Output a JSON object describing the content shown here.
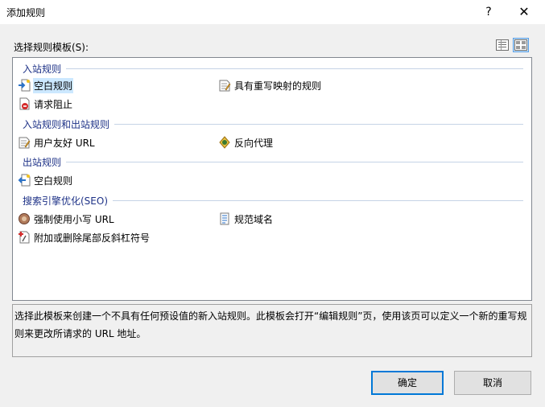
{
  "window": {
    "title": "添加规则",
    "help_glyph": "?",
    "close_glyph": "✕"
  },
  "select_label": "选择规则模板(S):",
  "view_buttons": [
    "list-view-icon",
    "tile-view-icon"
  ],
  "groups": [
    {
      "header": "入站规则",
      "items": [
        {
          "label": "空白规则",
          "icon": "inbound-blank-rule-icon",
          "selected": true
        },
        {
          "label": "具有重写映射的规则",
          "icon": "rewrite-map-rule-icon"
        },
        {
          "label": "请求阻止",
          "icon": "request-blocking-icon"
        }
      ]
    },
    {
      "header": "入站规则和出站规则",
      "items": [
        {
          "label": "用户友好 URL",
          "icon": "user-friendly-url-icon"
        },
        {
          "label": "反向代理",
          "icon": "reverse-proxy-icon"
        }
      ]
    },
    {
      "header": "出站规则",
      "items": [
        {
          "label": "空白规则",
          "icon": "outbound-blank-rule-icon"
        }
      ]
    },
    {
      "header": "搜索引擎优化(SEO)",
      "items": [
        {
          "label": "强制使用小写 URL",
          "icon": "enforce-lowercase-url-icon"
        },
        {
          "label": "规范域名",
          "icon": "canonical-domain-icon"
        },
        {
          "label": "附加或删除尾部反斜杠符号",
          "icon": "trailing-slash-icon"
        }
      ]
    }
  ],
  "description": "选择此模板来创建一个不具有任何预设值的新入站规则。此模板会打开“编辑规则”页，使用该页可以定义一个新的重写规则来更改所请求的 URL 地址。",
  "buttons": {
    "ok": "确定",
    "cancel": "取消"
  },
  "colors": {
    "group_header": "#1e3287",
    "selection": "#cce8ff",
    "dialog_bg": "#f0f0f0",
    "default_button_border": "#0078d7"
  }
}
